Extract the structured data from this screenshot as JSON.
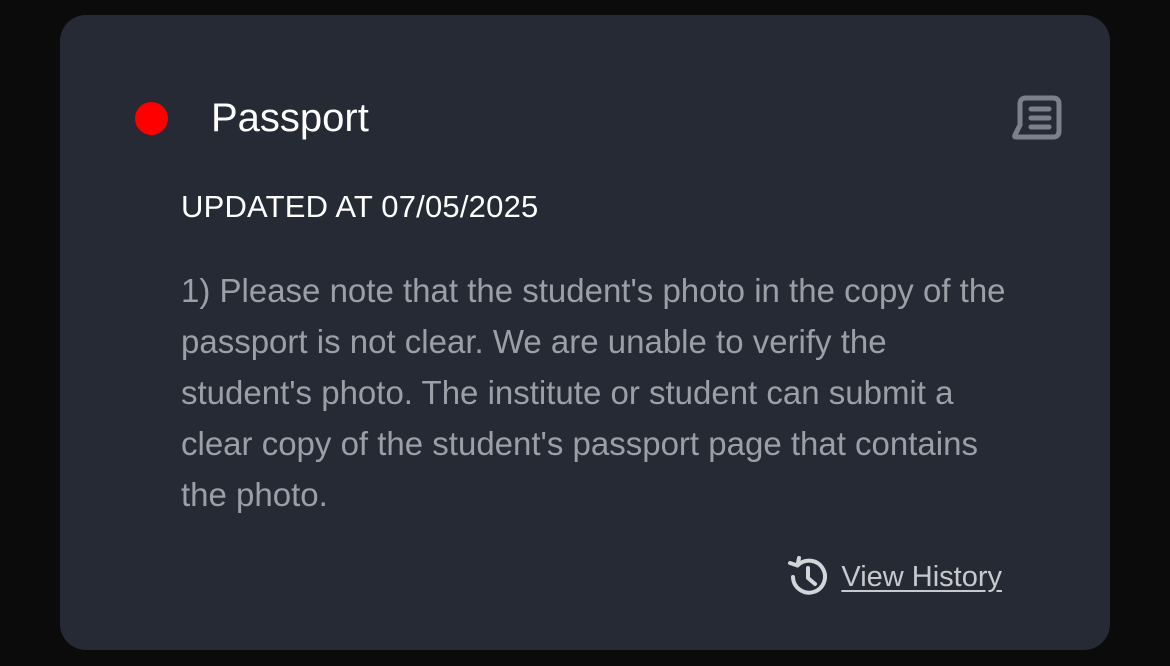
{
  "card": {
    "status_color": "#ff0000",
    "title": "Passport",
    "updated": "UPDATED AT 07/05/2025",
    "message": "1) Please note that the student's photo in the copy of the passport is not clear. We are unable to verify the student's photo. The institute or student can submit a clear copy of the student's passport page that contains the photo.",
    "notes_icon": "receipt-notes-icon",
    "history": {
      "icon": "history-icon",
      "label": "View History"
    }
  }
}
